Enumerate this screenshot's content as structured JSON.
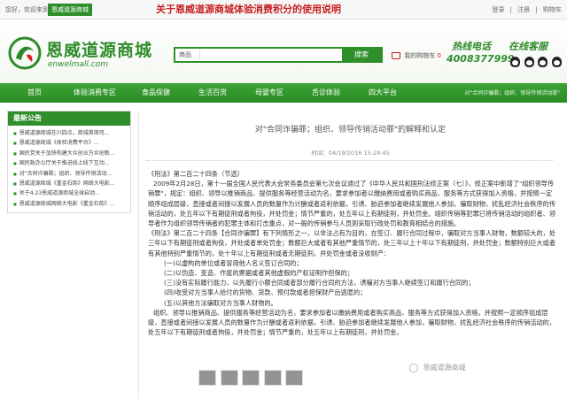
{
  "topbar": {
    "welcome": "您好，欢迎来到",
    "shop_name": "恩威道源商城",
    "headline": "关于恩威道源商城体验消费积分的使用说明",
    "links": [
      "登录",
      "注册",
      "购物车"
    ]
  },
  "header": {
    "logo_text": "恩威道源商城",
    "logo_domain": "enwelmall.com",
    "search": {
      "category": "商品",
      "placeholder": "",
      "button": "搜索"
    },
    "cart": {
      "label": "我的购物车",
      "count": "0"
    },
    "hotline_label": "热线电话",
    "hotline_number": "4008377999",
    "online_label": "在线客服"
  },
  "nav": [
    "首页",
    "体验消费专区",
    "食品保健",
    "生活百货",
    "母婴专区",
    "舌诊体验",
    "四大平台"
  ],
  "breadcrumb": "对\"合同诈骗罪；组织、领导传销活动罪\"",
  "sidebar": {
    "title": "最新公告",
    "items": [
      "恩威道源商城在川四点，商城首席司...",
      "恩威道源商城《体验消费平台》...",
      "国民党关于加快构建大众创业万众创新...",
      "国民政办公厅关于推进线上线下互动...",
      "对\"合同诈骗罪；组织、领导传销活动...",
      "恩威道源商城《重金石韵》网络大电影...",
      "关于4.23恩威道源商城全球启动...",
      "恩威道源商城网络大电影《重金石韵》..."
    ]
  },
  "article": {
    "title": "对\"合同诈骗罪；组织、领导传销活动罪\"的解释和认定",
    "meta": "时间：04/19/2016 15:29:45",
    "paragraphs": [
      {
        "style": "",
        "text": "《刑法》第二百二十四条（节选）"
      },
      {
        "style": "indent",
        "text": "2009年2月28日，第十一届全国人民代表大会常务委员会第七次会议通过了《中华人民共和国刑法修正案（七）》，修正案中新增了\"组织领导传销罪\"，规定：组织、领导以推销商品、提供服务等经营活动为名，要求参加者以缴纳费用或者购买商品、服务等方式获得加入资格，并按照一定顺序组成层级，直接或者间接以发展人员的数量作为计酬或者返利依据，引诱、胁迫参加者继续发展他人参加，骗取财物，扰乱经济社会秩序的传销活动的，处五年以下有期徒刑或者拘役，并处罚金；情节严重的，处五年以上有期徒刑，并处罚金。组织传销等犯罪已将传销活动的组织者、领导者作为组织领导传销者的犯罪主体和打击重点，对一般的传销参与人员则采取行政处罚和教育相结合的措施。"
      },
      {
        "style": "",
        "text": "《刑法》第二百二十四条【合同诈骗罪】有下列情形之一，以非法占有为目的，在签订、履行合同过程中，骗取对方当事人财物，数额较大的，处三年以下有期徒刑或者拘役，并处或者单处罚金；数额巨大或者有其他严重情节的，处三年以上十年以下有期徒刑，并处罚金；数额特别巨大或者有其他特别严重情节的，处十年以上有期徒刑或者无期徒刑，并处罚金或者没收财产："
      },
      {
        "style": "sub",
        "text": "(一)以虚构的单位或者冒用他人名义签订合同的；"
      },
      {
        "style": "sub",
        "text": "(二)以伪造、变造、作废的票据或者其他虚假的产权证明作担保的；"
      },
      {
        "style": "sub",
        "text": "(三)没有实际履行能力，以先履行小额合同或者部分履行合同的方法，诱骗对方当事人继续签订和履行合同的；"
      },
      {
        "style": "sub",
        "text": "(四)收受对方当事人给付的货物、货款、预付款或者担保财产后逃匿的；"
      },
      {
        "style": "sub",
        "text": "(五)以其他方法骗取对方当事人财物的。"
      },
      {
        "style": "indent",
        "text": "组织、领导以推销商品、提供服务等经营活动为名，要求参加者以缴纳费用或者购买商品、服务等方式获得加入资格，并按照一定顺序组成层级，直接或者间接以发展人员的数量作为计酬或者返利依据，引诱、胁迫参加者继续发展他人参加，骗取财物，扰乱经济社会秩序的传销活动的，处五年以下有期徒刑或者拘役，并处罚金；情节严重的，处五年以上有期徒刑，并处罚金。"
      }
    ]
  },
  "watermark": "恩威道源商城"
}
